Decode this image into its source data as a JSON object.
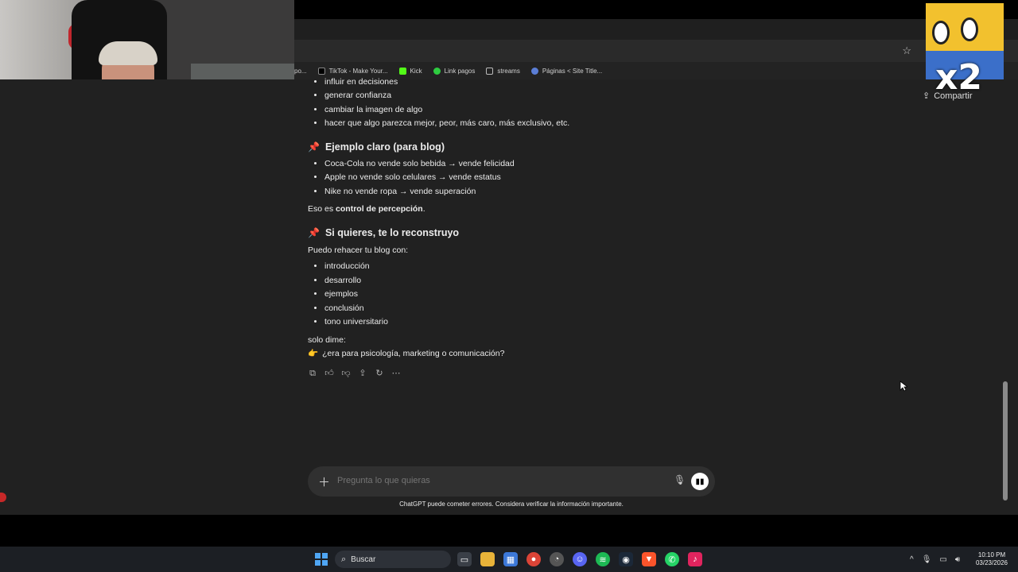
{
  "browser": {
    "bookmarks": [
      {
        "label": "po...",
        "icon": "page-icon",
        "color": "#555555"
      },
      {
        "label": "TikTok - Make Your...",
        "icon": "tiktok-icon",
        "color": "#000000"
      },
      {
        "label": "Kick",
        "icon": "kick-icon",
        "color": "#53fc18"
      },
      {
        "label": "Link pagos",
        "icon": "play-icon",
        "color": "#2ecc40"
      },
      {
        "label": "streams",
        "icon": "folder-icon",
        "color": "#9a9a9a"
      },
      {
        "label": "Páginas < Site Title...",
        "icon": "wordpress-icon",
        "color": "#5b7ed6"
      }
    ]
  },
  "chat": {
    "share_label": "Compartir",
    "list1": [
      "influir en decisiones",
      "generar confianza",
      "cambiar la imagen de algo",
      "hacer que algo parezca mejor, peor, más caro, más exclusivo, etc."
    ],
    "heading1": "Ejemplo claro (para blog)",
    "list2": [
      "Coca-Cola no vende solo bebida → vende felicidad",
      "Apple no vende solo celulares → vende estatus",
      "Nike no vende ropa → vende superación"
    ],
    "conclusion_prefix": "Eso es ",
    "conclusion_bold": "control de percepción",
    "conclusion_suffix": ".",
    "heading2": "Si quieres, te lo reconstruyo",
    "offer_intro": "Puedo rehacer tu blog con:",
    "list3": [
      "introducción",
      "desarrollo",
      "ejemplos",
      "conclusión",
      "tono universitario"
    ],
    "ask_line1": "solo dime:",
    "ask_line2": "¿era para psicología, marketing o comunicación?",
    "composer_placeholder": "Pregunta lo que quieras",
    "disclaimer": "ChatGPT puede cometer errores. Considera verificar la información importante."
  },
  "overlay": {
    "sticker_text": "x2"
  },
  "taskbar": {
    "search_label": "Buscar",
    "time": "10:10 PM",
    "date": "03/23/2026"
  }
}
